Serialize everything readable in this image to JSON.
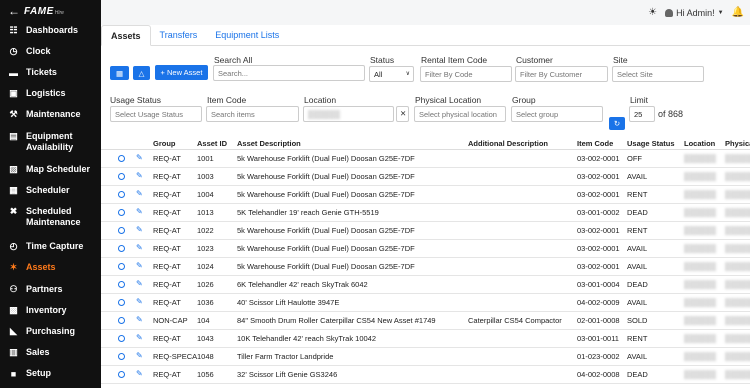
{
  "app": {
    "logo_text": "FAME",
    "logo_sub": "Hire"
  },
  "sidebar": {
    "items": [
      {
        "label": "Dashboards",
        "icon": "sitemap-icon"
      },
      {
        "label": "Clock",
        "icon": "clock-icon"
      },
      {
        "label": "Tickets",
        "icon": "ticket-icon"
      },
      {
        "label": "Logistics",
        "icon": "truck-icon"
      },
      {
        "label": "Maintenance",
        "icon": "wrench-icon"
      },
      {
        "label": "Equipment Availability",
        "icon": "forklift-icon"
      },
      {
        "label": "Map Scheduler",
        "icon": "map-icon"
      },
      {
        "label": "Scheduler",
        "icon": "calendar-icon"
      },
      {
        "label": "Scheduled Maintenance",
        "icon": "tools-icon"
      },
      {
        "label": "Time Capture",
        "icon": "stopwatch-icon"
      },
      {
        "label": "Assets",
        "icon": "assets-icon",
        "active": true
      },
      {
        "label": "Partners",
        "icon": "users-icon"
      },
      {
        "label": "Inventory",
        "icon": "boxes-icon"
      },
      {
        "label": "Purchasing",
        "icon": "cart-icon"
      },
      {
        "label": "Sales",
        "icon": "receipt-icon"
      },
      {
        "label": "Setup",
        "icon": "briefcase-icon"
      }
    ]
  },
  "topbar": {
    "user_label": "Hi Admin!"
  },
  "tabs": [
    {
      "label": "Assets",
      "active": true
    },
    {
      "label": "Transfers"
    },
    {
      "label": "Equipment Lists"
    }
  ],
  "toolbar": {
    "new_asset_label": "+ New Asset"
  },
  "filters": {
    "search_all": {
      "label": "Search All",
      "placeholder": "Search..."
    },
    "status": {
      "label": "Status",
      "value": "All"
    },
    "rental_item_code": {
      "label": "Rental Item Code",
      "placeholder": "Filter By Code"
    },
    "customer": {
      "label": "Customer",
      "placeholder": "Filter By Customer"
    },
    "site": {
      "label": "Site",
      "placeholder": "Select Site"
    },
    "usage_status": {
      "label": "Usage Status",
      "placeholder": "Select Usage Status"
    },
    "item_code": {
      "label": "Item Code",
      "placeholder": "Search items"
    },
    "location": {
      "label": "Location"
    },
    "physical_location": {
      "label": "Physical Location",
      "placeholder": "Select physical location"
    },
    "group": {
      "label": "Group",
      "placeholder": "Select group"
    },
    "limit": {
      "label": "Limit",
      "value": "25",
      "of_total": "of 868"
    }
  },
  "table": {
    "headers": [
      "Group",
      "Asset ID",
      "Asset Description",
      "Additional Description",
      "Item Code",
      "Usage Status",
      "Location",
      "Physica"
    ],
    "rows": [
      {
        "group": "REQ-AT",
        "asset_id": "1001",
        "desc": "5k Warehouse Forklift (Dual Fuel) Doosan G25E-7DF",
        "add_desc": "",
        "item_code": "03-002-0001",
        "usage": "OFF"
      },
      {
        "group": "REQ-AT",
        "asset_id": "1003",
        "desc": "5k Warehouse Forklift (Dual Fuel) Doosan G25E-7DF",
        "add_desc": "",
        "item_code": "03-002-0001",
        "usage": "AVAIL"
      },
      {
        "group": "REQ-AT",
        "asset_id": "1004",
        "desc": "5k Warehouse Forklift (Dual Fuel) Doosan G25E-7DF",
        "add_desc": "",
        "item_code": "03-002-0001",
        "usage": "RENT"
      },
      {
        "group": "REQ-AT",
        "asset_id": "1013",
        "desc": "5K Telehandler 19' reach Genie GTH-5519",
        "add_desc": "",
        "item_code": "03-001-0002",
        "usage": "DEAD"
      },
      {
        "group": "REQ-AT",
        "asset_id": "1022",
        "desc": "5k Warehouse Forklift (Dual Fuel) Doosan G25E-7DF",
        "add_desc": "",
        "item_code": "03-002-0001",
        "usage": "RENT"
      },
      {
        "group": "REQ-AT",
        "asset_id": "1023",
        "desc": "5k Warehouse Forklift (Dual Fuel) Doosan G25E-7DF",
        "add_desc": "",
        "item_code": "03-002-0001",
        "usage": "AVAIL"
      },
      {
        "group": "REQ-AT",
        "asset_id": "1024",
        "desc": "5k Warehouse Forklift (Dual Fuel) Doosan G25E-7DF",
        "add_desc": "",
        "item_code": "03-002-0001",
        "usage": "AVAIL"
      },
      {
        "group": "REQ-AT",
        "asset_id": "1026",
        "desc": "6K Telehandler 42' reach SkyTrak 6042",
        "add_desc": "",
        "item_code": "03-001-0004",
        "usage": "DEAD"
      },
      {
        "group": "REQ-AT",
        "asset_id": "1036",
        "desc": "40' Scissor Lift Haulotte 3947E",
        "add_desc": "",
        "item_code": "04-002-0009",
        "usage": "AVAIL"
      },
      {
        "group": "NON-CAP",
        "asset_id": "104",
        "desc": "84\" Smooth Drum Roller Caterpillar CS54 New Asset #1749",
        "add_desc": "Caterpillar CS54 Compactor",
        "item_code": "02-001-0008",
        "usage": "SOLD"
      },
      {
        "group": "REQ-AT",
        "asset_id": "1043",
        "desc": "10K Telehandler 42' reach SkyTrak 10042",
        "add_desc": "",
        "item_code": "03-001-0011",
        "usage": "RENT"
      },
      {
        "group": "REQ-SPECA",
        "asset_id": "1048",
        "desc": "Tiller Farm Tractor Landpride",
        "add_desc": "",
        "item_code": "01-023-0002",
        "usage": "AVAIL"
      },
      {
        "group": "REQ-AT",
        "asset_id": "1056",
        "desc": "32' Scissor Lift Genie GS3246",
        "add_desc": "",
        "item_code": "04-002-0008",
        "usage": "DEAD"
      }
    ]
  }
}
